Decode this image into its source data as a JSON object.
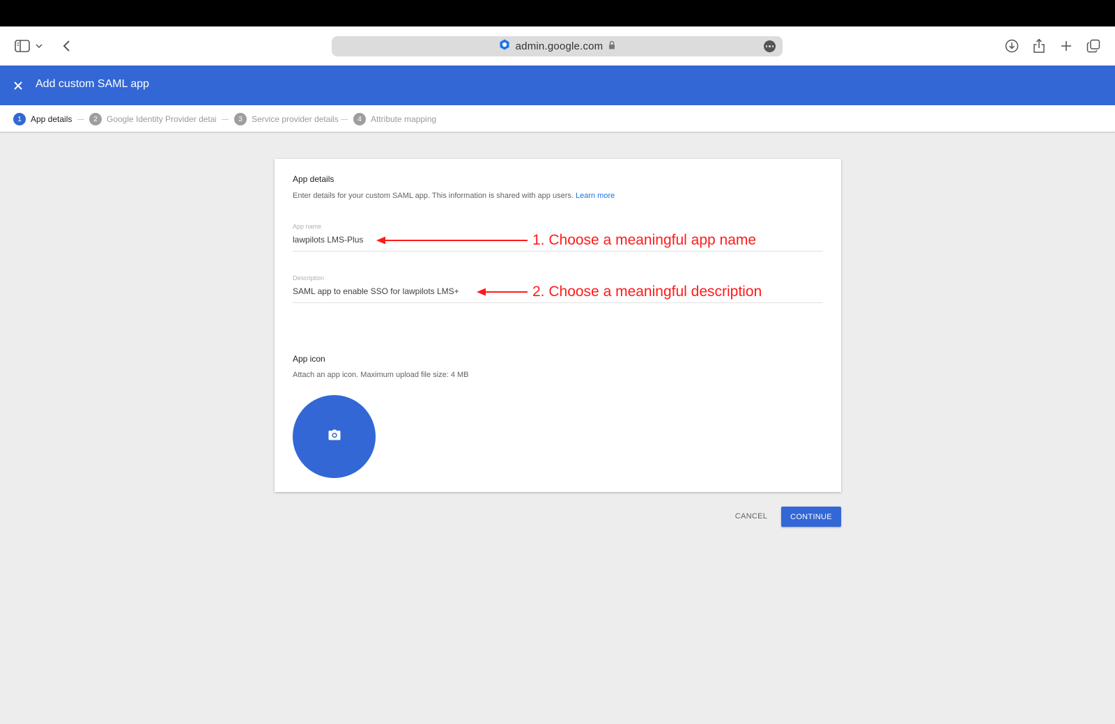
{
  "browser": {
    "url": "admin.google.com"
  },
  "header": {
    "title": "Add custom SAML app"
  },
  "stepper": {
    "steps": [
      {
        "number": "1",
        "label": "App details",
        "active": true
      },
      {
        "number": "2",
        "label": "Google Identity Provider detail:"
      },
      {
        "number": "3",
        "label": "Service provider details"
      },
      {
        "number": "4",
        "label": "Attribute mapping"
      }
    ]
  },
  "card": {
    "title": "App details",
    "description": "Enter details for your custom SAML app. This information is shared with app users.",
    "learn_more": "Learn more",
    "app_name": {
      "label": "App name",
      "value": "lawpilots LMS-Plus"
    },
    "app_description": {
      "label": "Description",
      "value": "SAML app to enable SSO for lawpilots LMS+"
    },
    "icon_section": {
      "title": "App icon",
      "description": "Attach an app icon. Maximum upload file size: 4 MB"
    }
  },
  "actions": {
    "cancel": "CANCEL",
    "continue": "CONTINUE"
  },
  "annotations": {
    "name": "1. Choose a meaningful app name",
    "description": "2. Choose a meaningful description"
  },
  "colors": {
    "accent": "#3367d6",
    "annotation": "#ff1a1a"
  }
}
